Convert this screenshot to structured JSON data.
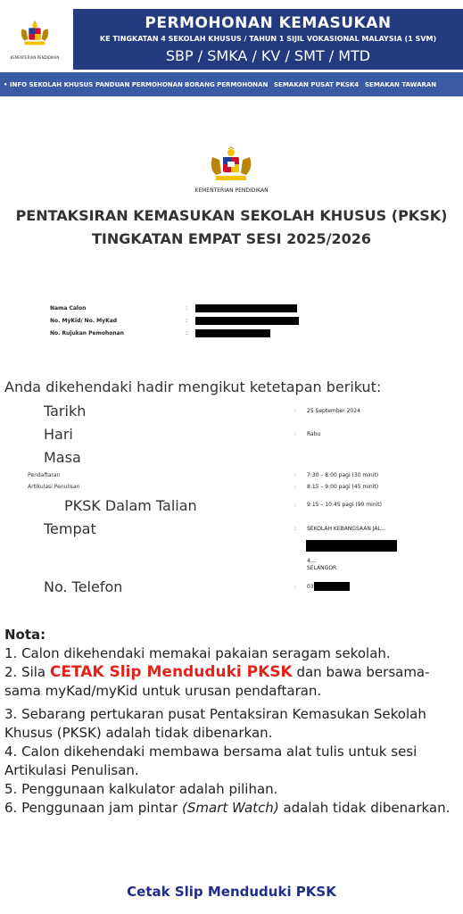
{
  "header": {
    "logo_caption": "KEMENTERIAN PENDIDIKAN",
    "title": "PERMOHONAN KEMASUKAN",
    "subtitle": "KE TINGKATAN 4 SEKOLAH KHUSUS / TAHUN 1 SIJIL VOKASIONAL MALAYSIA (1 SVM)",
    "schools": "SBP / SMKA / KV / SMT / MTD",
    "banner_color": "#233b7e",
    "nav_color": "#3b5aa6"
  },
  "nav": {
    "items": [
      {
        "label": "• INFO SEKOLAH KHUSUS"
      },
      {
        "label": "PANDUAN PERMOHONAN"
      },
      {
        "label": "BORANG PERMOHONAN"
      },
      {
        "label": "SEMAKAN PUSAT PKSK4"
      },
      {
        "label": "SEMAKAN TAWARAN"
      }
    ]
  },
  "slip": {
    "ministry": "KEMENTERIAN PENDIDIKAN",
    "title_line1": "PENTAKSIRAN KEMASUKAN SEKOLAH KHUSUS (PKSK)",
    "title_line2": "TINGKATAN EMPAT SESI 2025/2026",
    "candidate": {
      "name_label": "Nama Calon",
      "ic_label": "No. MyKid/ No. MyKad",
      "ref_label": "No. Rujukan Pemohonan",
      "colon": ":"
    },
    "intro": "Anda dikehendaki hadir mengikut ketetapan berikut:",
    "tarikh_label": "Tarikh",
    "tarikh_value": "25 September 2024",
    "hari_label": "Hari",
    "hari_value": "Rabu",
    "masa_label": "Masa",
    "pendaftaran_label": "Pendaftaran",
    "pendaftaran_value": "7:30 – 8:00 pagi (30 minit)",
    "artikulasi_label": "Artikulasi Penulisan",
    "artikulasi_value": "8:15 – 9:00 pagi (45 minit)",
    "pksk_label": "PKSK Dalam Talian",
    "pksk_value": "9:15 – 10:45 pagi (90 minit)",
    "tempat_label": "Tempat",
    "tempat_line1": "SEKOLAH KEBANGSAAN JAL...",
    "tempat_postcode": "4....",
    "tempat_state": "SELANGOR",
    "telefon_label": "No. Telefon",
    "telefon_prefix": "03",
    "colon": ":"
  },
  "notes": {
    "title": "Nota:",
    "n1": "1. Calon dikehendaki memakai pakaian seragam sekolah.",
    "n2_pre": "2. Sila ",
    "n2_highlight": "CETAK Slip Menduduki PKSK",
    "n2_post": " dan bawa bersama-sama myKad/myKid untuk urusan pendaftaran.",
    "n3": "3. Sebarang pertukaran pusat Pentaksiran Kemasukan Sekolah Khusus (PKSK) adalah tidak dibenarkan.",
    "n4": "4. Calon dikehendaki membawa bersama alat tulis untuk sesi Artikulasi Penulisan.",
    "n5": "5. Penggunaan kalkulator adalah pilihan.",
    "n6_pre": "6. Penggunaan jam pintar ",
    "n6_italic": "(Smart Watch)",
    "n6_post": " adalah tidak dibenarkan."
  },
  "footer": {
    "cetak_link": "Cetak Slip Menduduki PKSK"
  }
}
